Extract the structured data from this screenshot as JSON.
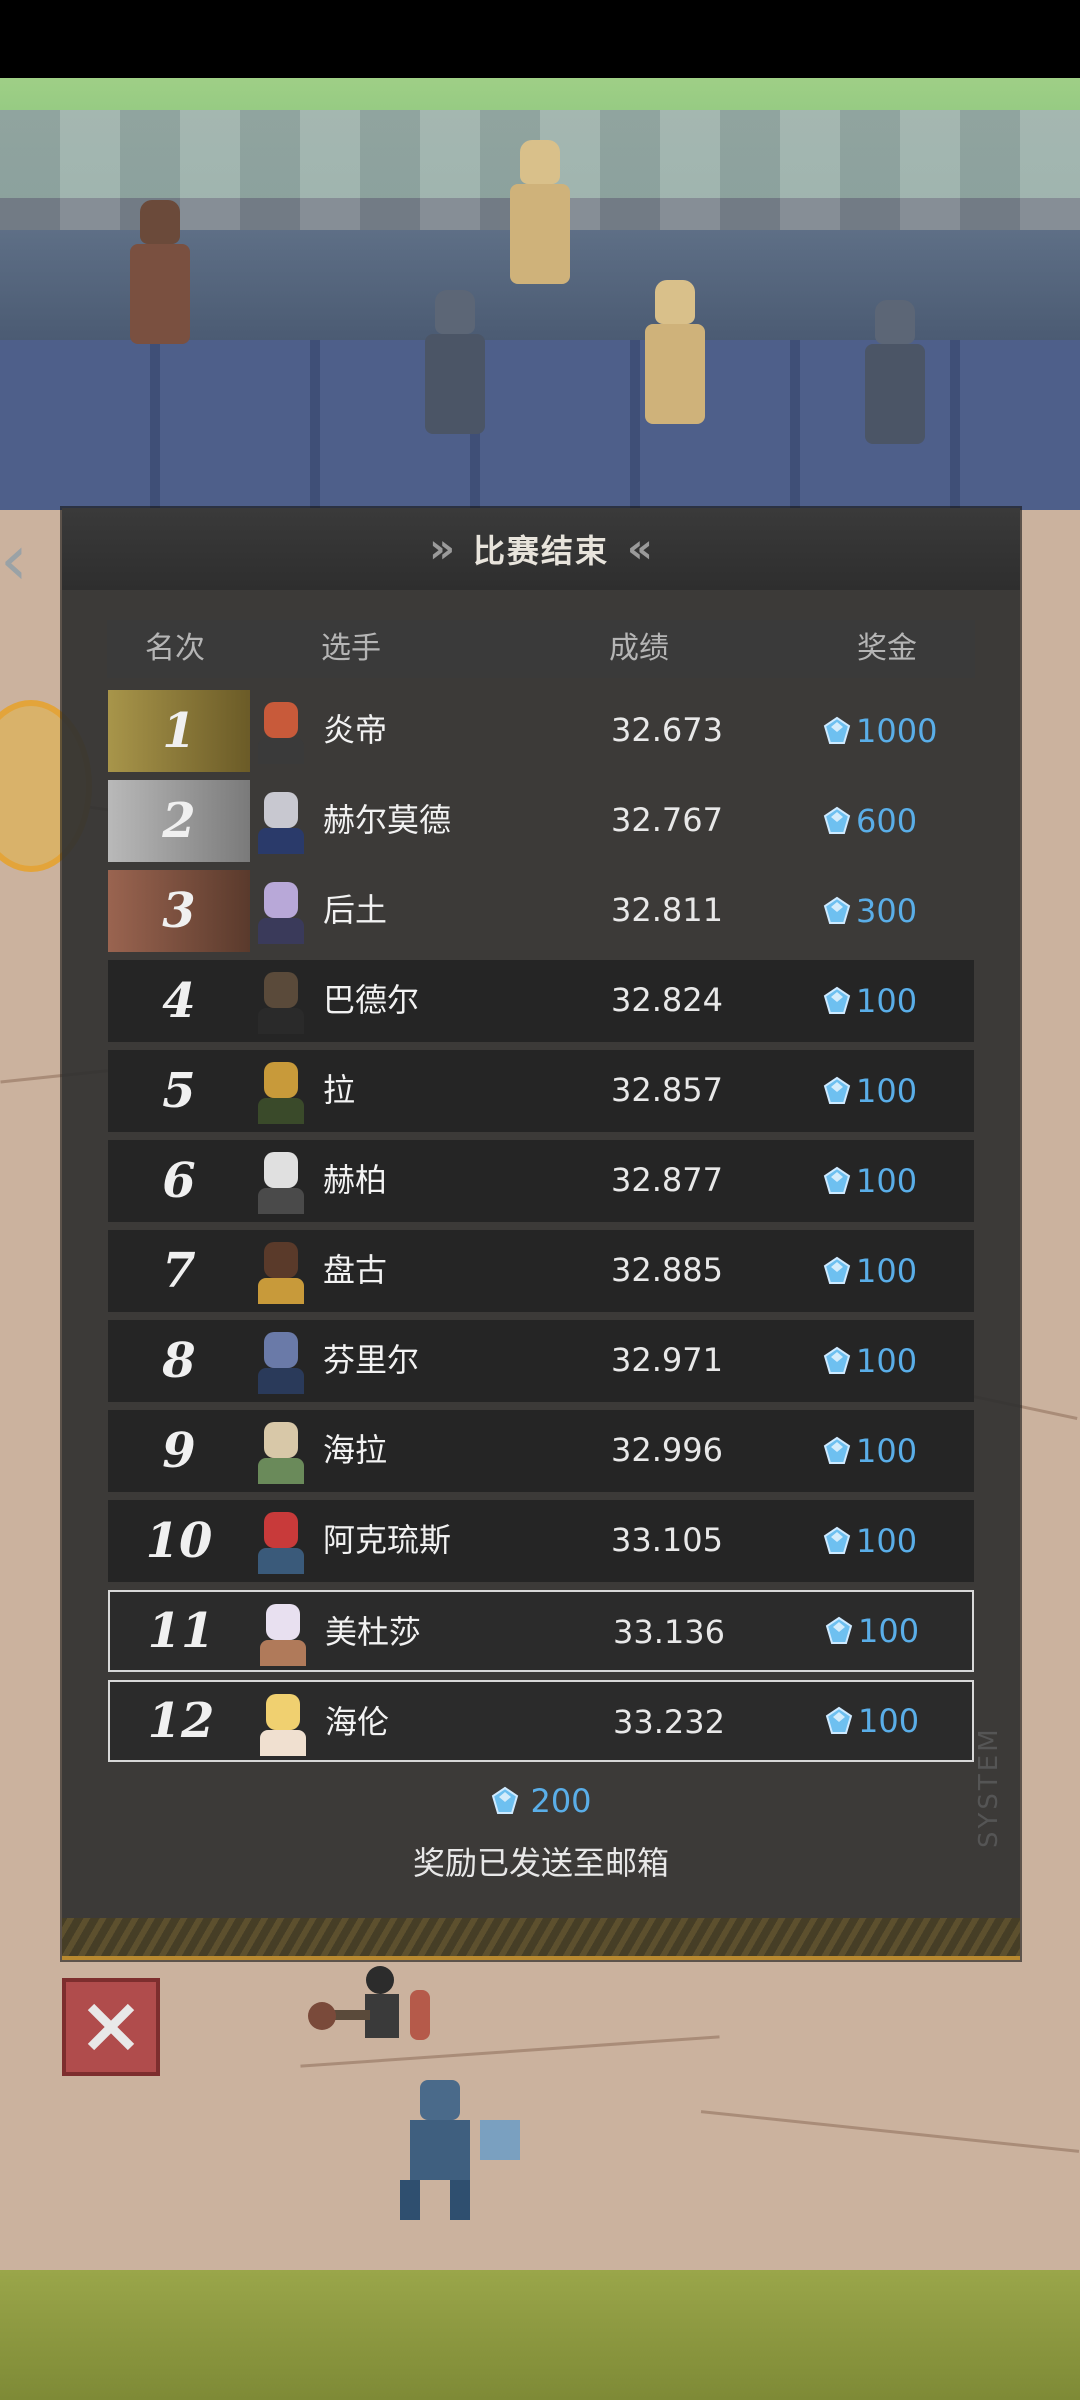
{
  "panel": {
    "title": "比赛结束",
    "columns": {
      "rank": "名次",
      "player": "选手",
      "score": "成绩",
      "prize": "奖金"
    }
  },
  "results": [
    {
      "rank": "1",
      "name": "炎帝",
      "score": "32.673",
      "prize": "1000"
    },
    {
      "rank": "2",
      "name": "赫尔莫德",
      "score": "32.767",
      "prize": "600"
    },
    {
      "rank": "3",
      "name": "后土",
      "score": "32.811",
      "prize": "300"
    },
    {
      "rank": "4",
      "name": "巴德尔",
      "score": "32.824",
      "prize": "100"
    },
    {
      "rank": "5",
      "name": "拉",
      "score": "32.857",
      "prize": "100"
    },
    {
      "rank": "6",
      "name": "赫柏",
      "score": "32.877",
      "prize": "100"
    },
    {
      "rank": "7",
      "name": "盘古",
      "score": "32.885",
      "prize": "100"
    },
    {
      "rank": "8",
      "name": "芬里尔",
      "score": "32.971",
      "prize": "100"
    },
    {
      "rank": "9",
      "name": "海拉",
      "score": "32.996",
      "prize": "100"
    },
    {
      "rank": "10",
      "name": "阿克琉斯",
      "score": "33.105",
      "prize": "100"
    },
    {
      "rank": "11",
      "name": "美杜莎",
      "score": "33.136",
      "prize": "100"
    },
    {
      "rank": "12",
      "name": "海伦",
      "score": "33.232",
      "prize": "100"
    }
  ],
  "reward": {
    "total": "200",
    "note": "奖励已发送至邮箱"
  },
  "panel_tag": "SYSTEM",
  "colors": {
    "prize_blue": "#5aaee8",
    "gold": "#a8954a",
    "silver": "#b9b9b9",
    "bronze": "#9a6450",
    "close_red": "#b04c4c"
  },
  "icons": {
    "gem": "gem-icon",
    "close": "close-icon"
  }
}
